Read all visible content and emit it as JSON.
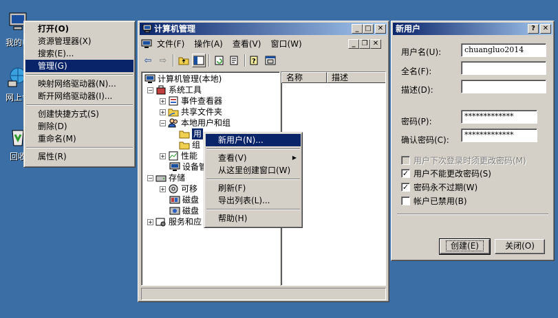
{
  "desktop": {
    "icons": [
      {
        "label": "我的电",
        "icon": "computer-icon"
      },
      {
        "label": "网上邻",
        "icon": "network-icon"
      },
      {
        "label": "回收",
        "icon": "recycle-bin-icon"
      }
    ]
  },
  "context_menu": {
    "items": [
      {
        "label": "打开(O)",
        "bold": true
      },
      {
        "label": "资源管理器(X)"
      },
      {
        "label": "搜索(E)..."
      },
      {
        "label": "管理(G)",
        "selected": true
      },
      {
        "label": "映射网络驱动器(N)..."
      },
      {
        "label": "断开网络驱动器(I)..."
      },
      {
        "label": "创建快捷方式(S)"
      },
      {
        "label": "删除(D)"
      },
      {
        "label": "重命名(M)"
      },
      {
        "label": "属性(R)"
      }
    ]
  },
  "mmc": {
    "title": "计算机管理",
    "menubar": [
      "文件(F)",
      "操作(A)",
      "查看(V)",
      "窗口(W)"
    ],
    "tree": {
      "root": "计算机管理(本地)",
      "system_tools": "系统工具",
      "event_viewer": "事件查看器",
      "shared_folders": "共享文件夹",
      "local_users_groups": "本地用户和组",
      "users_partial": "用",
      "groups_partial": "组",
      "perf_partial": "性能",
      "device_partial": "设备管",
      "storage": "存储",
      "removable_partial": "可移",
      "disk1_partial": "磁盘",
      "disk2_partial": "磁盘",
      "services_partial": "服务和应"
    },
    "columns": [
      "名称",
      "描述"
    ]
  },
  "submenu": {
    "items": [
      {
        "label": "新用户(N)...",
        "selected": true
      },
      {
        "label": "查看(V)",
        "arrow": "▶"
      },
      {
        "label": "从这里创建窗口(W)"
      },
      {
        "label": "刷新(F)"
      },
      {
        "label": "导出列表(L)..."
      },
      {
        "label": "帮助(H)"
      }
    ]
  },
  "dialog": {
    "title": "新用户",
    "help_btn": "?",
    "close_btn": "✕",
    "username_label": "用户名(U):",
    "username_value": "chuangluo2014",
    "fullname_label": "全名(F):",
    "fullname_value": "",
    "desc_label": "描述(D):",
    "desc_value": "",
    "password_label": "密码(P):",
    "password_value": "*************",
    "confirm_label": "确认密码(C):",
    "confirm_value": "*************",
    "checks": [
      {
        "label": "用户下次登录时须更改密码(M)",
        "checked": false,
        "disabled": true
      },
      {
        "label": "用户不能更改密码(S)",
        "checked": true,
        "disabled": false
      },
      {
        "label": "密码永不过期(W)",
        "checked": true,
        "disabled": false
      },
      {
        "label": "帐户已禁用(B)",
        "checked": false,
        "disabled": false
      }
    ],
    "create_btn": "创建(E)",
    "close_label": "关闭(O)"
  }
}
